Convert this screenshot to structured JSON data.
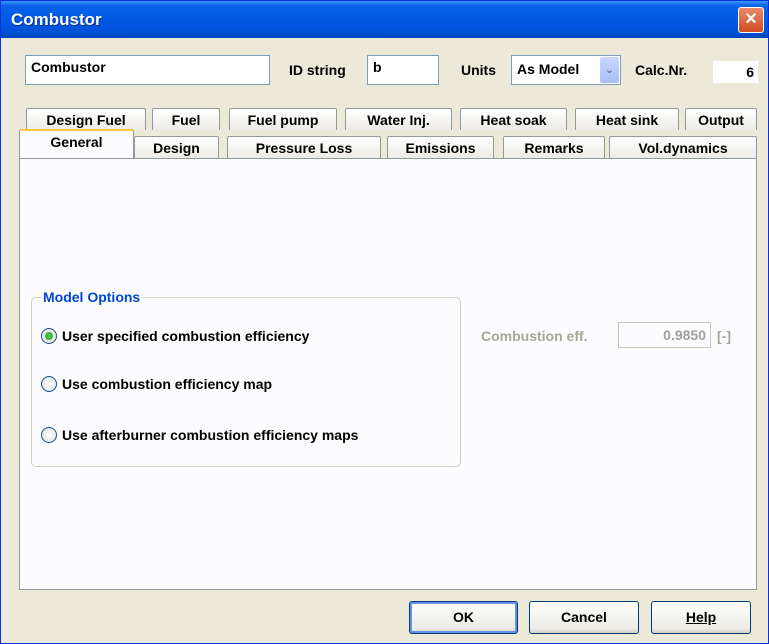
{
  "window": {
    "title": "Combustor",
    "close_icon": "×"
  },
  "header": {
    "name_value": "Combustor",
    "id_label": "ID string",
    "id_value": "b",
    "units_label": "Units",
    "units_value": "As Model",
    "units_arrow": "⌄",
    "calc_label": "Calc.Nr.",
    "calc_value": "6"
  },
  "tabs_row1": [
    "Design Fuel",
    "Fuel",
    "Fuel pump",
    "Water Inj.",
    "Heat soak",
    "Heat sink",
    "Output"
  ],
  "tabs_row2": [
    "General",
    "Design",
    "Pressure Loss",
    "Emissions",
    "Remarks",
    "Vol.dynamics"
  ],
  "active_tab": "General",
  "model_options": {
    "title": "Model Options",
    "options": [
      {
        "label": "User specified combustion efficiency",
        "checked": true
      },
      {
        "label": "Use combustion efficiency map",
        "checked": false
      },
      {
        "label": "Use afterburner combustion efficiency maps",
        "checked": false
      }
    ]
  },
  "combustion_eff": {
    "label": "Combustion eff.",
    "value": "0.9850",
    "unit": "[-]"
  },
  "buttons": {
    "ok": "OK",
    "cancel": "Cancel",
    "help": "Help"
  }
}
